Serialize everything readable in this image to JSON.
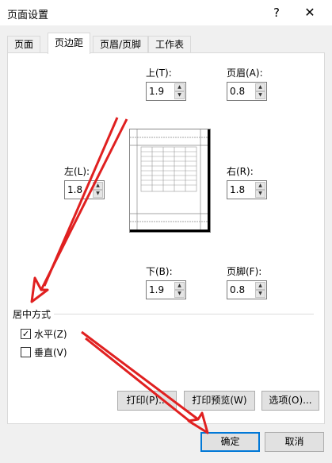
{
  "window": {
    "title": "页面设置",
    "help_label": "?",
    "close_label": "✕"
  },
  "tabs": [
    {
      "label": "页面",
      "active": false
    },
    {
      "label": "页边距",
      "active": true
    },
    {
      "label": "页眉/页脚",
      "active": false
    },
    {
      "label": "工作表",
      "active": false
    }
  ],
  "margins": {
    "top": {
      "label": "上(T):",
      "value": "1.9"
    },
    "header": {
      "label": "页眉(A):",
      "value": "0.8"
    },
    "left": {
      "label": "左(L):",
      "value": "1.8"
    },
    "right": {
      "label": "右(R):",
      "value": "1.8"
    },
    "bottom": {
      "label": "下(B):",
      "value": "1.9"
    },
    "footer": {
      "label": "页脚(F):",
      "value": "0.8"
    }
  },
  "center": {
    "group_label": "居中方式",
    "horizontal": {
      "label": "水平(Z)",
      "checked": true
    },
    "vertical": {
      "label": "垂直(V)",
      "checked": false
    }
  },
  "buttons": {
    "print": "打印(P)...",
    "print_preview": "打印预览(W)",
    "options": "选项(O)...",
    "ok": "确定",
    "cancel": "取消"
  },
  "colors": {
    "annotation_arrow": "#e02020",
    "ok_border": "#0078d7"
  }
}
